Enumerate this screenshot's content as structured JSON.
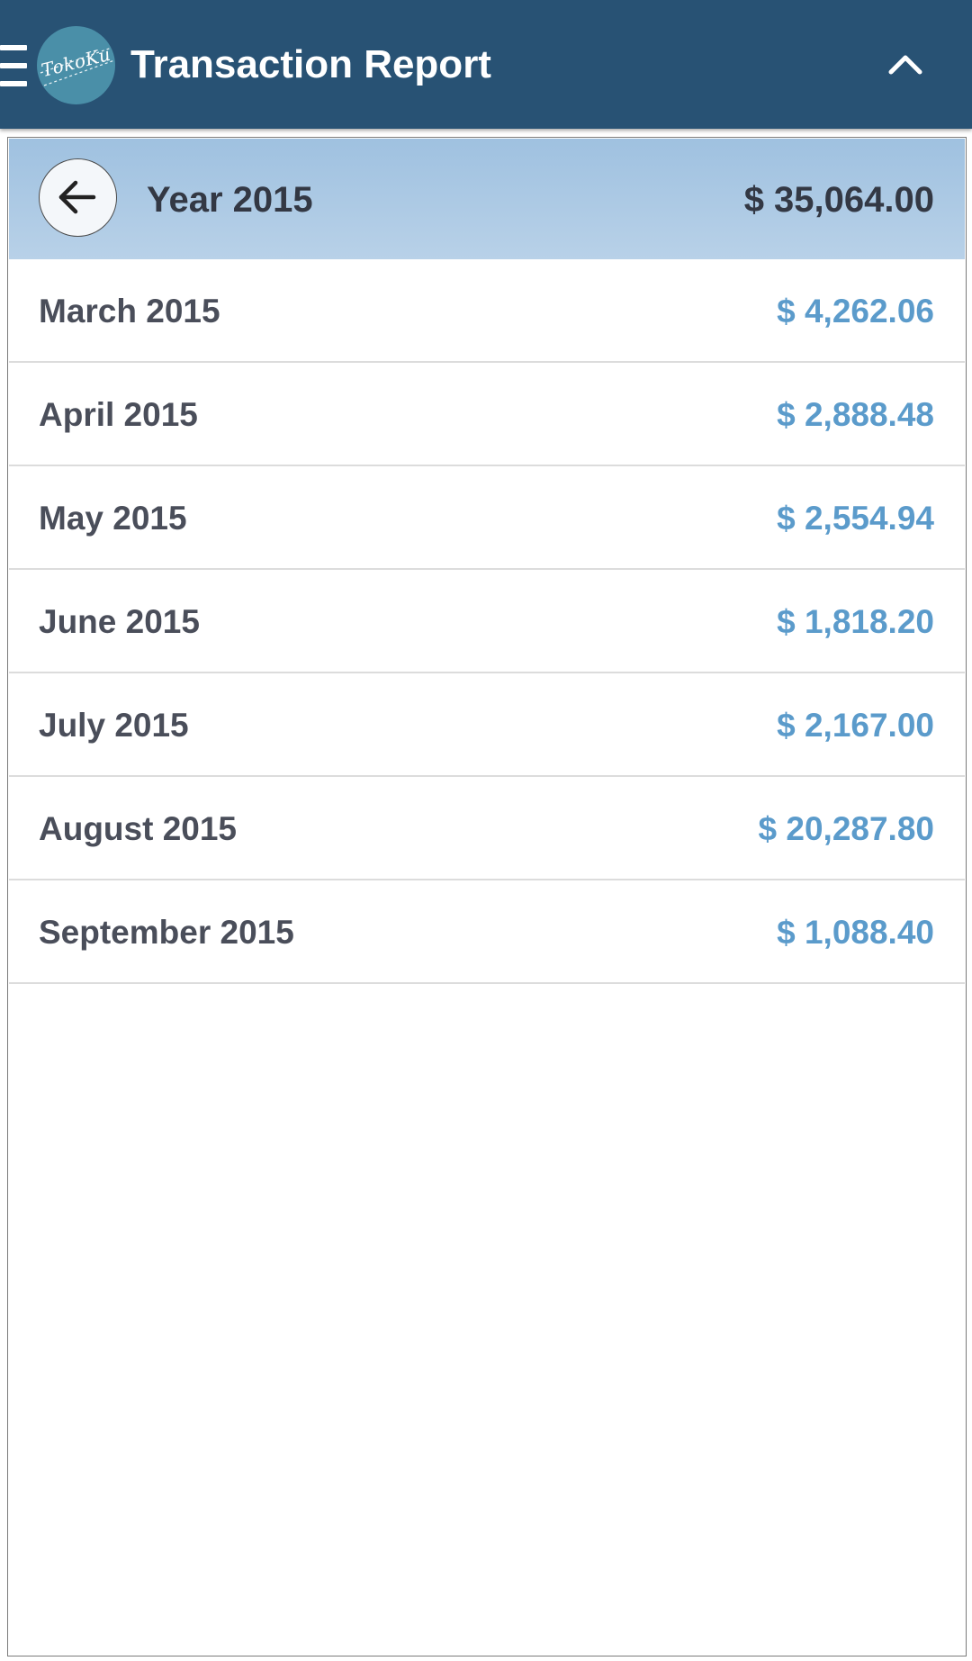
{
  "appbar": {
    "title": "Transaction Report",
    "logo_text": "TokoKu",
    "menu_icon": "hamburger-menu-icon",
    "collapse_icon": "chevron-up-icon",
    "background_color": "#285274"
  },
  "report": {
    "year_label": "Year 2015",
    "year_total": "$ 35,064.00",
    "back_icon": "arrow-left-icon",
    "amount_color": "#5b9bcb",
    "months": [
      {
        "label": "March 2015",
        "amount": "$ 4,262.06"
      },
      {
        "label": "April 2015",
        "amount": "$ 2,888.48"
      },
      {
        "label": "May 2015",
        "amount": "$ 2,554.94"
      },
      {
        "label": "June 2015",
        "amount": "$ 1,818.20"
      },
      {
        "label": "July 2015",
        "amount": "$ 2,167.00"
      },
      {
        "label": "August 2015",
        "amount": "$ 20,287.80"
      },
      {
        "label": "September 2015",
        "amount": "$ 1,088.40"
      }
    ]
  }
}
